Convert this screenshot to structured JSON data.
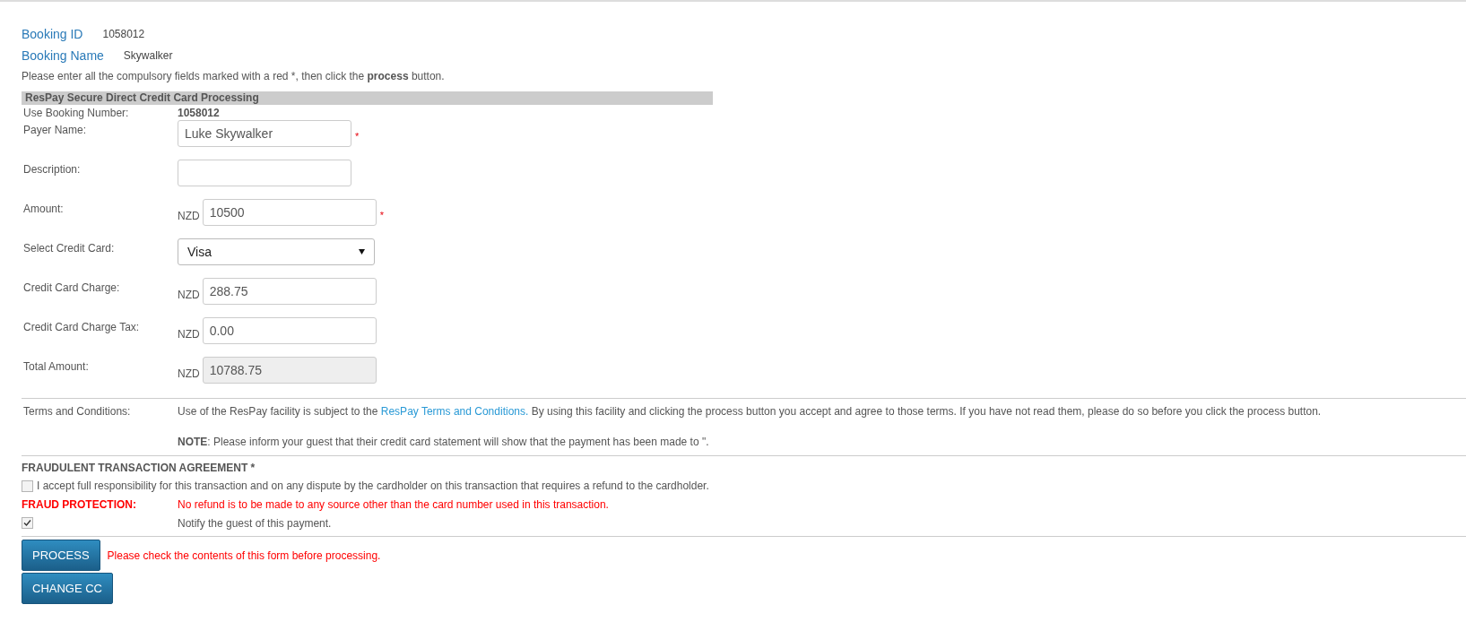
{
  "booking": [
    {
      "label": "Booking ID",
      "value": "1058012"
    },
    {
      "label": "Booking Name",
      "value": "Skywalker"
    }
  ],
  "instruction": "Please enter all the compulsory fields marked with a red *, then click the **process** button.",
  "section_title": "ResPay Secure Direct Credit Card Processing",
  "booking_number": {
    "label": "Use Booking Number:",
    "value": "1058012"
  },
  "fields": [
    {
      "kind": "text",
      "label": "Payer Name:",
      "value": "Luke Skywalker",
      "required": true
    },
    {
      "kind": "text",
      "label": "Description:",
      "required": false
    },
    {
      "kind": "text",
      "label": "Amount:",
      "prefix": "NZD",
      "value": "10500",
      "required": true
    },
    {
      "kind": "select",
      "label": "Select Credit Card:",
      "value": "Visa",
      "required": false
    },
    {
      "kind": "text",
      "label": "Credit Card Charge:",
      "prefix": "NZD",
      "value": "288.75",
      "required": false
    },
    {
      "kind": "text",
      "label": "Credit Card Charge Tax:",
      "prefix": "NZD",
      "value": "0.00",
      "required": false
    },
    {
      "kind": "readonly",
      "label": "Total Amount:",
      "prefix": "NZD",
      "value": "10788.75",
      "required": false
    }
  ],
  "required_mark": "*",
  "terms": {
    "label": "Terms and Conditions:",
    "before": "Use of the ResPay facility is subject to the",
    "link": "ResPay Terms and Conditions.",
    "after": "By using this facility and clicking the process button you accept and agree to those terms. If you have not read them, please do so before you click the process button.",
    "note": "**NOTE**: Please inform your guest that their credit card statement will show that the payment has been made to \"."
  },
  "agreement": {
    "title": "FRAUDULENT TRANSACTION AGREEMENT *",
    "checked": false,
    "text": "I accept full responsibility for this transaction and on any dispute by the cardholder on this transaction that requires a refund to the cardholder."
  },
  "fraud": {
    "label": "FRAUD PROTECTION:",
    "text": "No refund is to be made to any source other than the card number used in this transaction."
  },
  "notify": {
    "checked": true,
    "text": "Notify the guest of this payment."
  },
  "buttons": [
    "PROCESS",
    "CHANGE CC"
  ],
  "warning": "Please check the contents of this form before processing."
}
